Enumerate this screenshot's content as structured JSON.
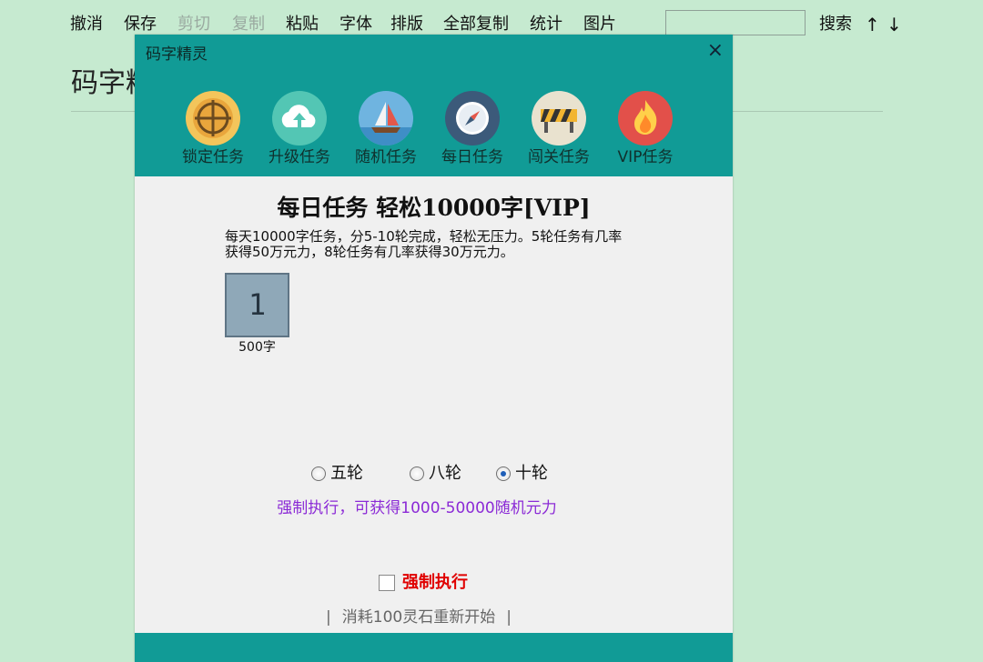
{
  "toolbar": {
    "items": [
      {
        "label": "撤消",
        "enabled": true
      },
      {
        "label": "保存",
        "enabled": true
      },
      {
        "label": "剪切",
        "enabled": false
      },
      {
        "label": "复制",
        "enabled": false
      },
      {
        "label": "粘贴",
        "enabled": true
      },
      {
        "label": "字体",
        "enabled": true
      },
      {
        "label": "排版",
        "enabled": true
      },
      {
        "label": "全部复制",
        "enabled": true
      },
      {
        "label": "统计",
        "enabled": true
      },
      {
        "label": "图片",
        "enabled": true
      }
    ],
    "search_value": "",
    "search_button": "搜索",
    "up_arrow": "↑",
    "down_arrow": "↓"
  },
  "document": {
    "title": "码字精灵:爱码字"
  },
  "dialog": {
    "title": "码字精灵",
    "close_glyph": "×",
    "tasks": [
      {
        "label": "锁定任务",
        "icon": "crosshair-icon"
      },
      {
        "label": "升级任务",
        "icon": "cloud-upload-icon"
      },
      {
        "label": "随机任务",
        "icon": "sailboat-icon"
      },
      {
        "label": "每日任务",
        "icon": "compass-icon"
      },
      {
        "label": "闯关任务",
        "icon": "roadblock-icon"
      },
      {
        "label": "VIP任务",
        "icon": "flame-icon"
      }
    ],
    "heading": "每日任务 轻松10000字[VIP]",
    "description": "每天10000字任务，分5-10轮完成，轻松无压力。5轮任务有几率获得50万元力，8轮任务有几率获得30万元力。",
    "rounds": [
      {
        "number": "1",
        "caption": "500字"
      }
    ],
    "radio_options": [
      {
        "label": "五轮",
        "checked": false
      },
      {
        "label": "八轮",
        "checked": false
      },
      {
        "label": "十轮",
        "checked": true
      }
    ],
    "force_note": "强制执行，可获得1000-50000随机元力",
    "force_checkbox": {
      "label": "强制执行",
      "checked": false
    },
    "restart": {
      "separator": "|",
      "label": "消耗100灵石重新开始"
    }
  },
  "colors": {
    "background": "#c6ead0",
    "dialog_teal": "#119b96",
    "purple_note": "#8b2ad6",
    "red_label": "#e00000",
    "tile": "#8fa8b8"
  }
}
